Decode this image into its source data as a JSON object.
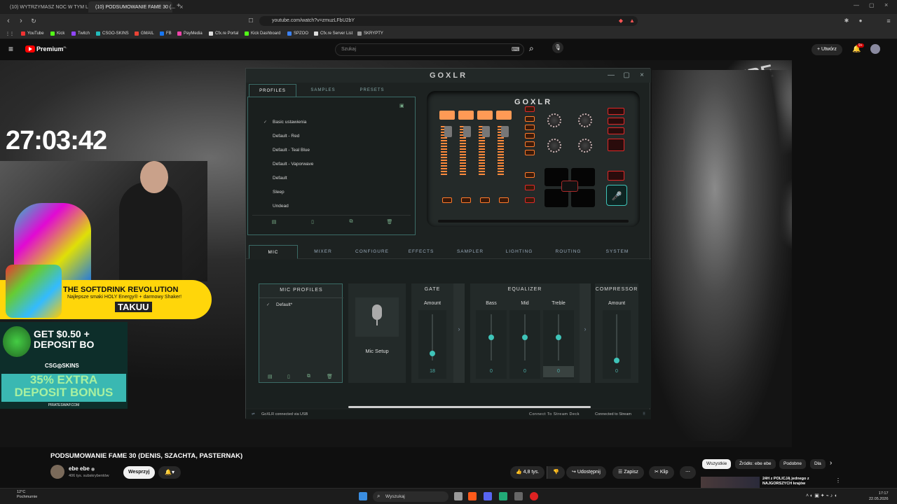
{
  "browser": {
    "tabs": [
      {
        "label": "(10) WYTRZYMASZ NOC W TYM LO..."
      },
      {
        "label": "(10) PODSUMOWANIE FAME 30 (..."
      }
    ],
    "url": "youtube.com/watch?v=zmuzLFbU2bY",
    "bookmarks": [
      "YouTube",
      "Kick",
      "Twitch",
      "CSGO-SKINS",
      "GMAIL",
      "FB",
      "PayMedia",
      "Cfx.re Portal",
      "Kick Dashboard",
      "SPZOO",
      "Cfx.re Server List",
      "SKRYPTY"
    ]
  },
  "youtube": {
    "logo": "Premium",
    "logo_sup": "PL",
    "search_placeholder": "Szukaj",
    "create_label": "Utwórz",
    "notifications_count": "9+"
  },
  "video_overlay": {
    "timer": "27:03:42",
    "banner1_title": "THE SOFTDRINK REVOLUTION",
    "banner1_sub": "Najlepsze smaki HOLY Energy® + darmowy Shaker!",
    "banner1_brand": "TAKUU",
    "banner2_line1": "GET $0.50 +",
    "banner2_line2": "DEPOSIT BO",
    "banner2_brand": "CSG◎SKINS",
    "banner2_promo1": "35% EXTRA",
    "banner2_promo2": "DEPOSIT BONUS",
    "banner2_site": "PIRATESWAP.COM",
    "fighter_sign": "EBE"
  },
  "goxlr": {
    "title": "GOXLR",
    "top_tabs": [
      "PROFILES",
      "SAMPLES",
      "PRESETS"
    ],
    "profiles": [
      "Basic ustawienia",
      "Default - Red",
      "Default - Teal Blue",
      "Default - Vaporwave",
      "Default",
      "Sleep",
      "Undead"
    ],
    "selected_profile_check": "✓",
    "device_logo": "GOXLR",
    "bottom_tabs": [
      "MIC",
      "MIXER",
      "CONFIGURE",
      "EFFECTS",
      "SAMPLER",
      "LIGHTING",
      "ROUTING",
      "SYSTEM"
    ],
    "mic_profiles_title": "MIC PROFILES",
    "mic_profile_item": "Default*",
    "mic_setup_label": "Mic Setup",
    "gate": {
      "title": "GATE",
      "label": "Amount",
      "value": "18",
      "level": 0.15
    },
    "equalizer": {
      "title": "EQUALIZER",
      "bands": [
        {
          "label": "Bass",
          "value": "0",
          "level": 0.5
        },
        {
          "label": "Mid",
          "value": "0",
          "level": 0.5
        },
        {
          "label": "Treble",
          "value": "0",
          "level": 0.5
        }
      ]
    },
    "compressor": {
      "title": "COMPRESSOR",
      "label": "Amount",
      "value": "0",
      "level": 0.0
    },
    "status_left": "GoXLR connected via USB",
    "status_mid": "Connect To Stream Deck",
    "status_right": "Connected to Stream"
  },
  "video_info": {
    "title": "PODSUMOWANIE FAME 30 (DENIS, SZACHTA, PASTERNAK)",
    "channel": "ebe ebe",
    "subscribers": "406 tys. subskrybentów",
    "support_label": "Wesprzyj",
    "likes": "4,8 tys.",
    "share_label": "Udostępnij",
    "save_label": "Zapisz",
    "clip_label": "Klip"
  },
  "chips": [
    "Wszystkie",
    "Źródło: ebe ebe",
    "Podobne",
    "Dla"
  ],
  "recommended_title": "24H z POLICJĄ jednego z NAJGORSZYCH krajów",
  "taskbar": {
    "weather_temp": "12°C",
    "weather_desc": "Pochmurnie",
    "search_label": "Wyszukaj",
    "time": "17:17",
    "date": "22.05.2026"
  },
  "colors": {
    "youtube_red": "#ff0000",
    "goxlr_accent": "#3fc4b9",
    "goxlr_orange": "#ff8a3c",
    "goxlr_red": "#e02828"
  }
}
